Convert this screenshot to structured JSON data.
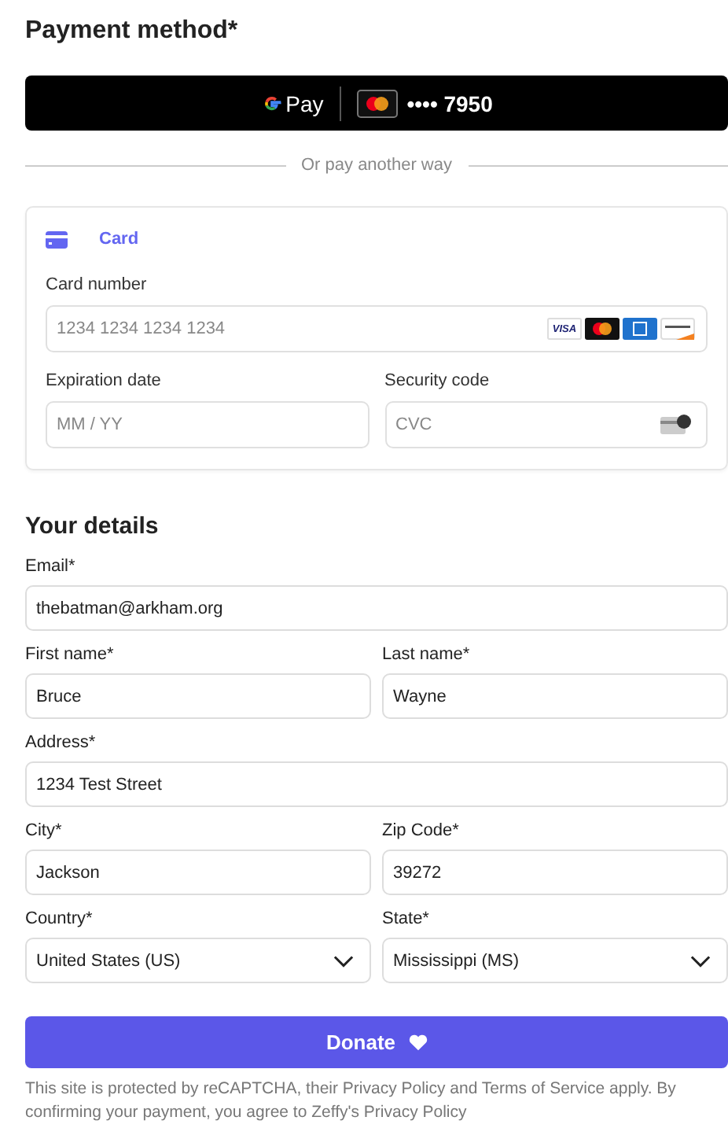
{
  "payment": {
    "title": "Payment method*",
    "gpay": {
      "label": "Pay",
      "masked": "•••• 7950"
    },
    "divider": "Or pay another way",
    "card_tab": {
      "label": "Card",
      "selected": true
    },
    "card_number": {
      "label": "Card number",
      "placeholder": "1234 1234 1234 1234"
    },
    "brands": [
      {
        "kind": "visa",
        "text": "VISA"
      },
      {
        "kind": "mastercard"
      },
      {
        "kind": "amex"
      },
      {
        "kind": "discover"
      }
    ],
    "expiry": {
      "label": "Expiration date",
      "placeholder": "MM / YY"
    },
    "cvc": {
      "label": "Security code",
      "placeholder": "CVC"
    }
  },
  "details": {
    "title": "Your details",
    "rows": [
      [
        {
          "label": "Email*",
          "value": "thebatman@arkham.org",
          "kind": "text"
        }
      ],
      [
        {
          "label": "First name*",
          "value": "Bruce",
          "kind": "text"
        },
        {
          "label": "Last name*",
          "value": "Wayne",
          "kind": "text"
        }
      ],
      [
        {
          "label": "Address*",
          "value": "1234 Test Street",
          "kind": "text"
        }
      ],
      [
        {
          "label": "City*",
          "value": "Jackson",
          "kind": "text"
        },
        {
          "label": "Zip Code*",
          "value": "39272",
          "kind": "text"
        }
      ],
      [
        {
          "label": "Country*",
          "value": "United States (US)",
          "kind": "select"
        },
        {
          "label": "State*",
          "value": "Mississippi (MS)",
          "kind": "select"
        }
      ]
    ]
  },
  "donate": {
    "label": "Donate"
  },
  "footer": "This site is protected by reCAPTCHA, their Privacy Policy and Terms of Service apply. By confirming your payment, you agree to Zeffy's Privacy Policy"
}
